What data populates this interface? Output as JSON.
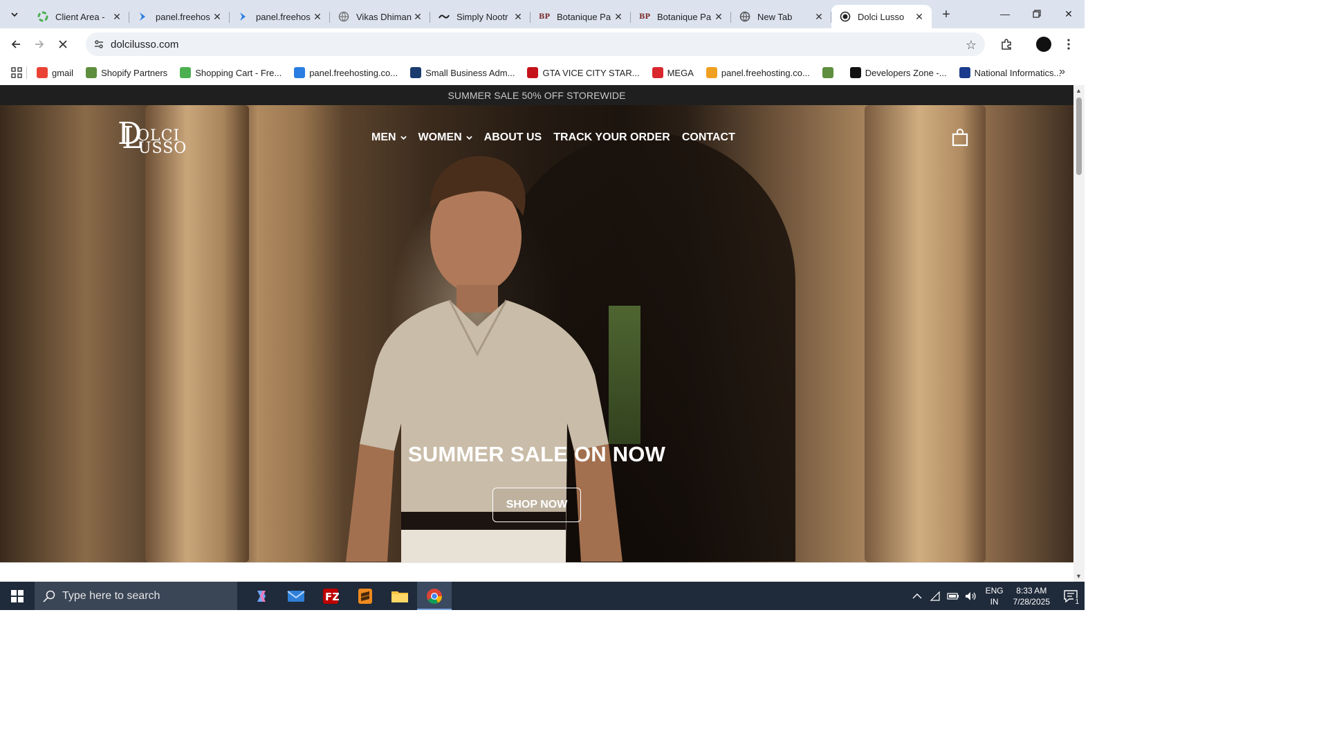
{
  "browser": {
    "tabs": [
      {
        "title": "Client Area -",
        "favicon": "spinner-color",
        "color": "#4caf50"
      },
      {
        "title": "panel.freehos",
        "favicon": "chevron-blue",
        "color": "#2a7de1"
      },
      {
        "title": "panel.freehos",
        "favicon": "chevron-blue",
        "color": "#2a7de1"
      },
      {
        "title": "Vikas Dhiman",
        "favicon": "globe",
        "color": "#777777"
      },
      {
        "title": "Simply Nootr",
        "favicon": "wave",
        "color": "#222222"
      },
      {
        "title": "Botanique Pa",
        "favicon": "BP",
        "color": "#7a2a2a"
      },
      {
        "title": "Botanique Pa",
        "favicon": "BP",
        "color": "#7a2a2a"
      },
      {
        "title": "New Tab",
        "favicon": "chrome",
        "color": "#555555"
      },
      {
        "title": "Dolci Lusso",
        "favicon": "dl-logo",
        "color": "#222222",
        "active": true
      }
    ],
    "url": "dolcilusso.com",
    "bookmarks": [
      {
        "label": "gmail",
        "icon": "gmail-icon",
        "color": "#ea4335"
      },
      {
        "label": "Shopify Partners",
        "icon": "shopify-icon",
        "color": "#5e8e3e"
      },
      {
        "label": "Shopping Cart - Fre...",
        "icon": "spinner-icon",
        "color": "#4caf50"
      },
      {
        "label": "panel.freehosting.co...",
        "icon": "chevron-icon",
        "color": "#2a7de1"
      },
      {
        "label": "Small Business Adm...",
        "icon": "sba-icon",
        "color": "#1a3b6d"
      },
      {
        "label": "GTA VICE CITY STAR...",
        "icon": "gta-icon",
        "color": "#c4121a"
      },
      {
        "label": "MEGA",
        "icon": "mega-icon",
        "color": "#d9272e"
      },
      {
        "label": "panel.freehosting.co...",
        "icon": "pma-icon",
        "color": "#f0a020"
      },
      {
        "label": "",
        "icon": "shopify-icon",
        "color": "#5e8e3e"
      },
      {
        "label": "Developers Zone -...",
        "icon": "dev-icon",
        "color": "#111111"
      },
      {
        "label": "National Informatics...",
        "icon": "nic-icon",
        "color": "#1a3b8d"
      }
    ]
  },
  "site": {
    "announcement": "SUMMER SALE 50% OFF STOREWIDE",
    "brand": {
      "mark": "DL",
      "line1": "OLCI",
      "line2": "USSO"
    },
    "nav": [
      {
        "label": "MEN",
        "dropdown": true
      },
      {
        "label": "WOMEN",
        "dropdown": true
      },
      {
        "label": "ABOUT US",
        "dropdown": false
      },
      {
        "label": "TRACK YOUR ORDER",
        "dropdown": false
      },
      {
        "label": "CONTACT",
        "dropdown": false
      }
    ],
    "hero": {
      "title": "SUMMER SALE ON NOW",
      "cta": "SHOP NOW"
    }
  },
  "taskbar": {
    "search_placeholder": "Type here to search",
    "lang_line1": "ENG",
    "lang_line2": "IN",
    "time": "8:33 AM",
    "date": "7/28/2025",
    "notifications": "1"
  }
}
